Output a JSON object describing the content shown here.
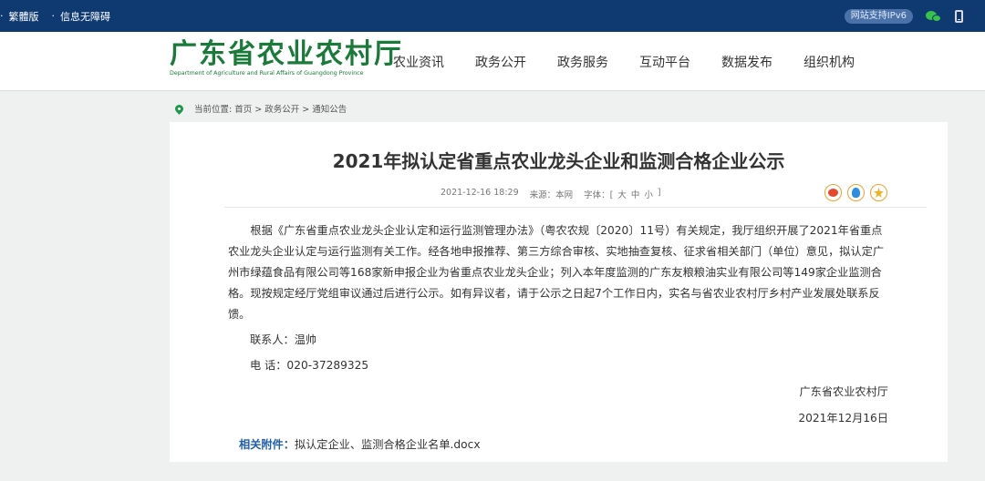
{
  "topbar": {
    "traditional": "繁體版",
    "accessible": "信息无障碍",
    "ipv6": "网站支持IPv6"
  },
  "header": {
    "logo_cn": "广东省农业农村厅",
    "logo_en": "Department of Agriculture and Rural Affairs of Guangdong Province",
    "nav": [
      "农业资讯",
      "政务公开",
      "政务服务",
      "互动平台",
      "数据发布",
      "组织机构"
    ]
  },
  "breadcrumb": "当前位置: 首页 > 政务公开 > 通知公告",
  "article": {
    "title": "2021年拟认定省重点农业龙头企业和监测合格企业公示",
    "datetime": "2021-12-16 18:29",
    "source": "来源：本网",
    "font_label": "字体：[",
    "font_large": "大",
    "font_medium": "中",
    "font_small": "小",
    "font_close": "]",
    "paragraph": "根据《广东省重点农业龙头企业认定和运行监测管理办法》（粤农农规〔2020〕11号）有关规定，我厅组织开展了2021年省重点农业龙头企业认定与运行监测有关工作。经各地申报推荐、第三方综合审核、实地抽查复核、征求省相关部门（单位）意见，拟认定广州市绿蕴食品有限公司等168家新申报企业为省重点农业龙头企业；列入本年度监测的广东友粮粮油实业有限公司等149家企业监测合格。现按规定经厅党组审议通过后进行公示。如有异议者，请于公示之日起7个工作日内，实名与省农业农村厅乡村产业发展处联系反馈。",
    "contact": "联系人：温帅",
    "phone": "电  话：020-37289325",
    "org": "广东省农业农村厅",
    "date": "2021年12月16日",
    "attach_label": "相关附件：",
    "attach_file": "拟认定企业、监测合格企业名单.docx"
  },
  "colors": {
    "topbar": "#0f3a71",
    "brand_green": "#1a7a3a",
    "link_blue": "#1f5fb0"
  }
}
